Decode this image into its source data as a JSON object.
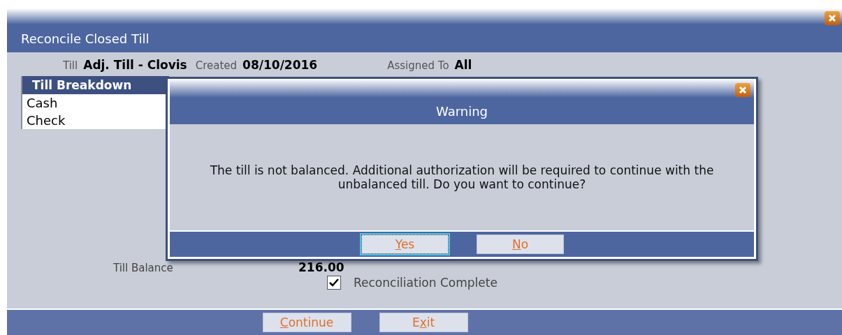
{
  "window": {
    "title": "Reconcile Closed Till"
  },
  "info": [
    {
      "label": "Till",
      "value": "Adj. Till - Clovis"
    },
    {
      "label": "Created",
      "value": "08/10/2016"
    },
    {
      "label": "Assigned To",
      "value": "All"
    }
  ],
  "breakdown": {
    "heading": "Till Breakdown",
    "items": [
      "Cash",
      "Check"
    ]
  },
  "balance": {
    "label": "Till Balance",
    "value": "216.00"
  },
  "reconciliation": {
    "label": "Reconciliation Complete",
    "checked": true
  },
  "buttons": [
    {
      "key": "C",
      "rest": "ontinue"
    },
    {
      "lead": "E",
      "key": "x",
      "rest": "it"
    }
  ],
  "dialog": {
    "title": "Warning",
    "message": "The till is not balanced. Additional authorization will be required to continue with the unbalanced till. Do you want to continue?",
    "buttons": [
      {
        "key": "Y",
        "rest": "es",
        "focused": true
      },
      {
        "key": "N",
        "rest": "o",
        "focused": false
      }
    ]
  }
}
